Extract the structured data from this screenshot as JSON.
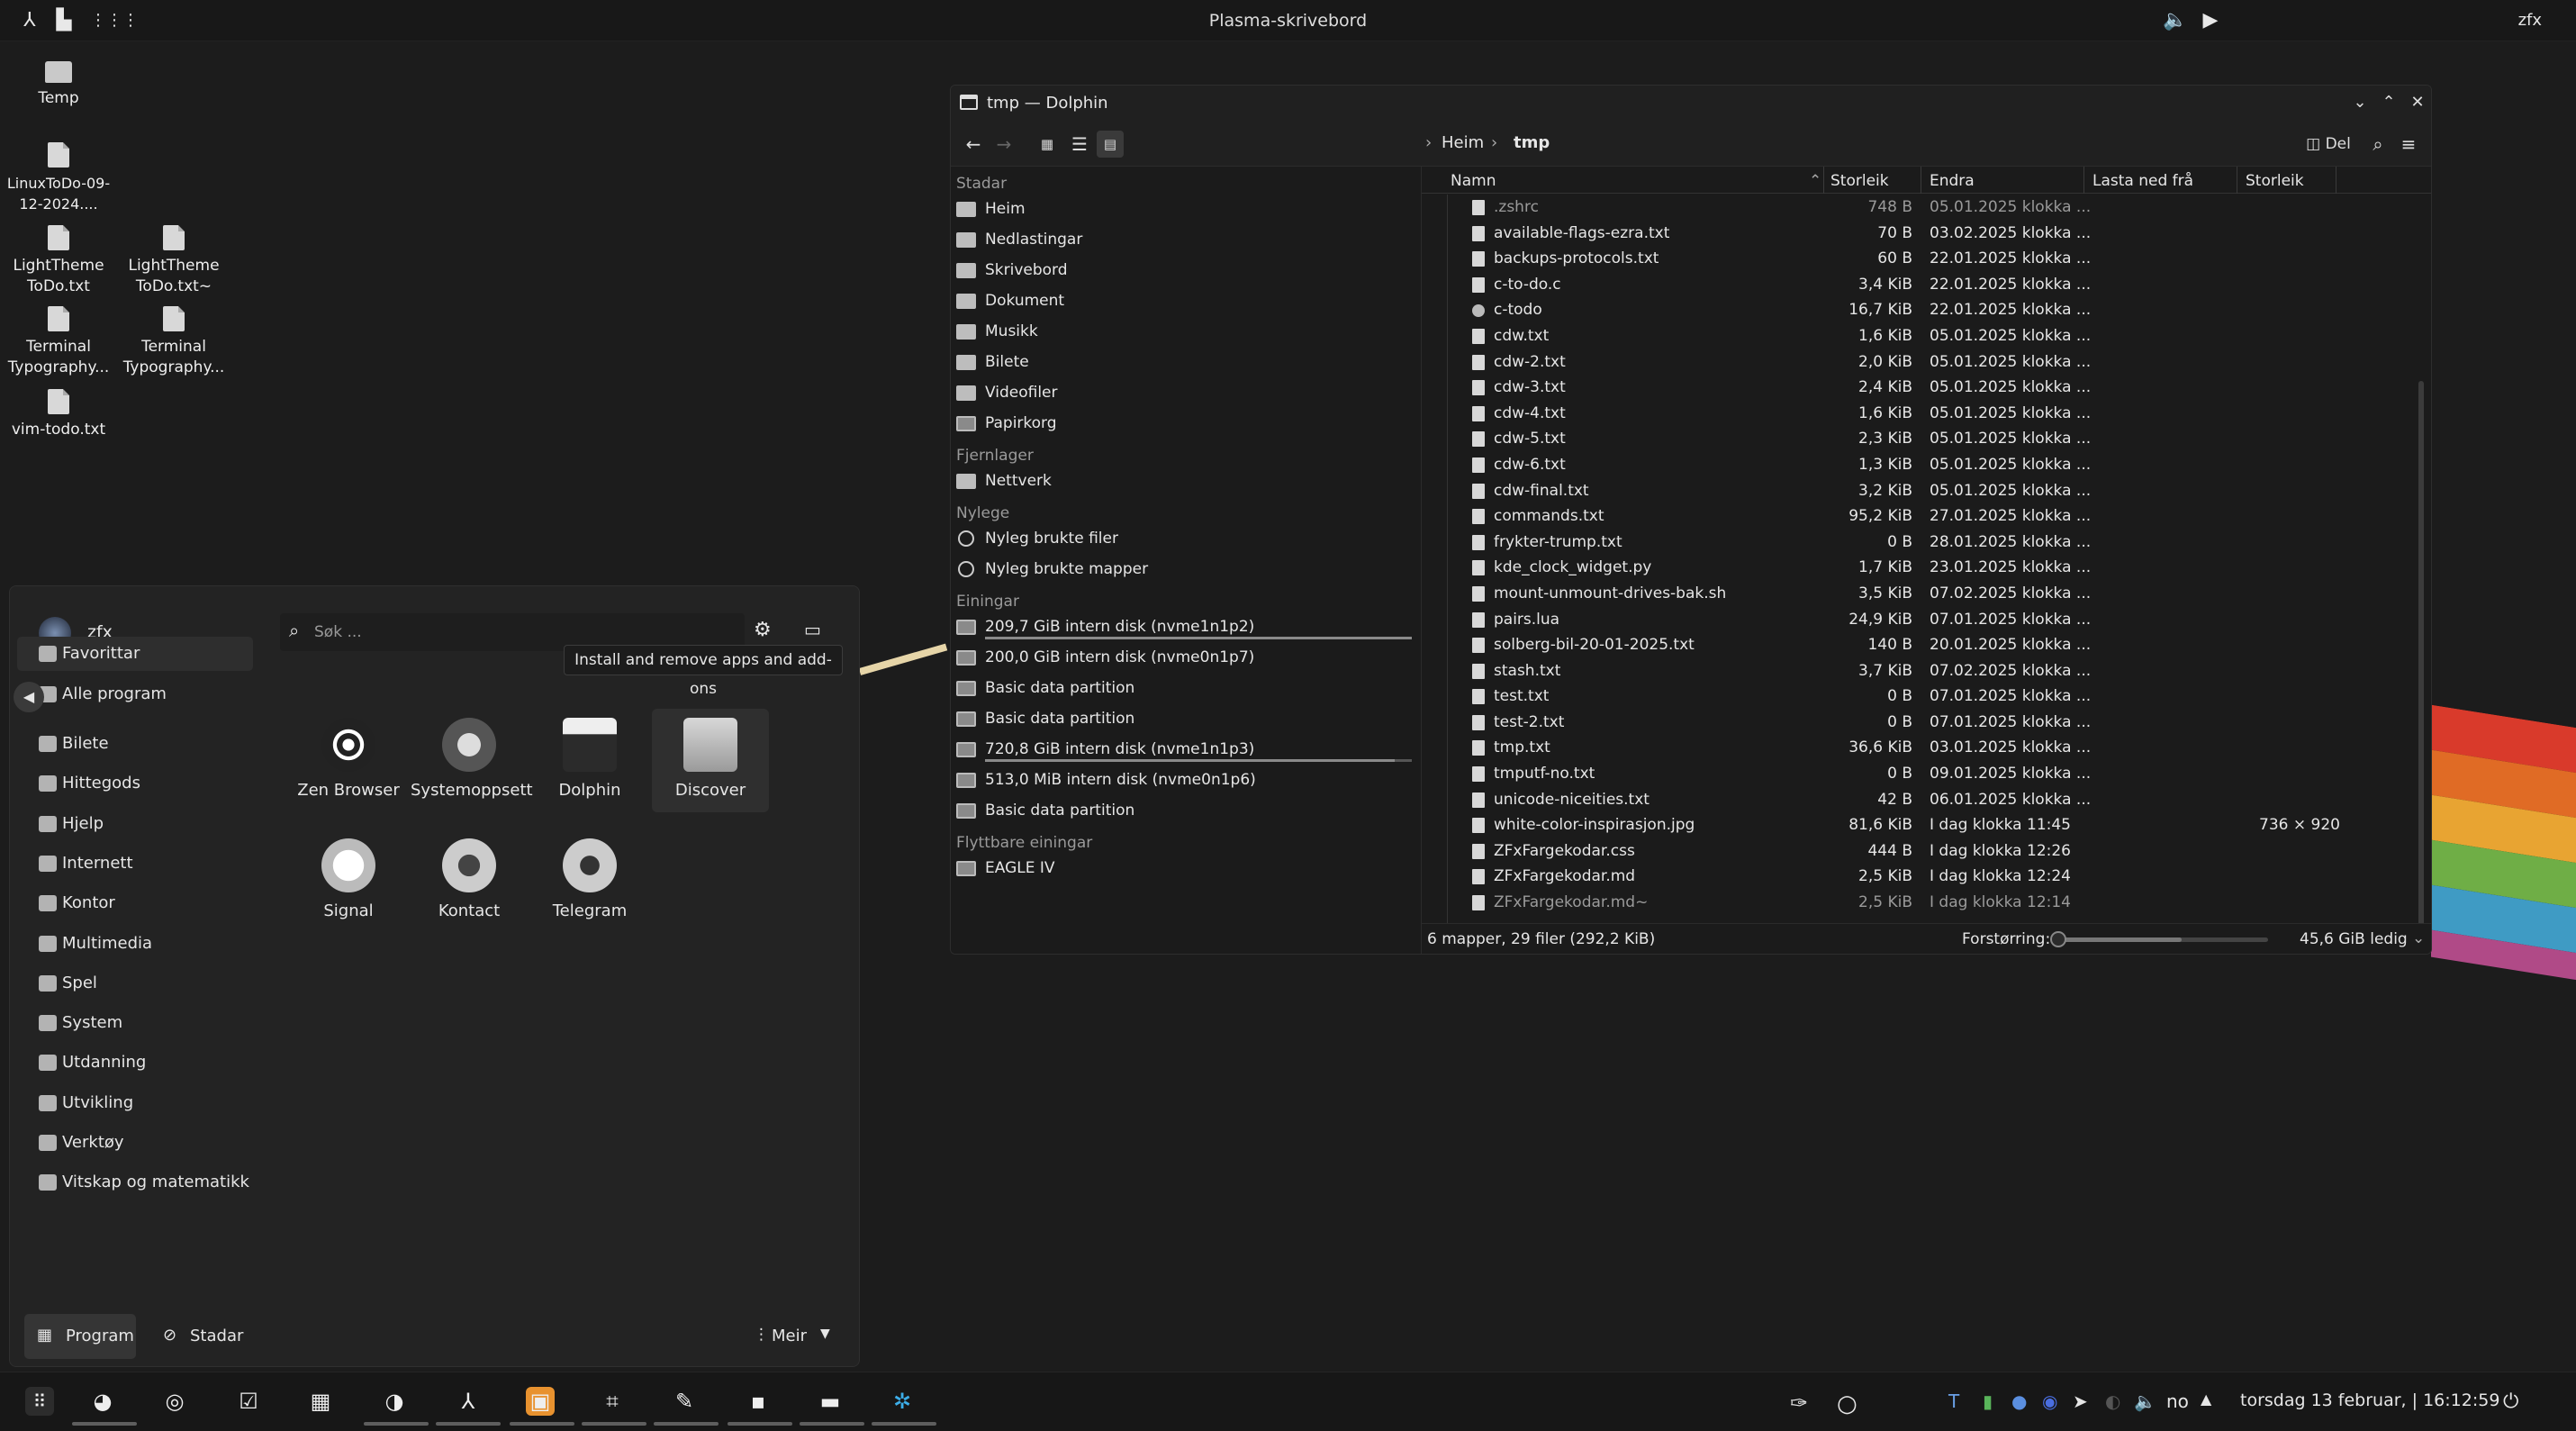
{
  "topbar": {
    "title": "Plasma-skrivebord",
    "user": "zfx"
  },
  "desktop": {
    "icons": [
      {
        "label": "Temp",
        "kind": "folder"
      },
      {
        "label": "LinuxToDo-09-12-2024....",
        "kind": "file"
      },
      {
        "label": "LightTheme ToDo.txt",
        "kind": "file"
      },
      {
        "label": "LightTheme ToDo.txt~",
        "kind": "file"
      },
      {
        "label": "Terminal Typography...",
        "kind": "file"
      },
      {
        "label": "Terminal Typography...",
        "kind": "file"
      },
      {
        "label": "vim-todo.txt",
        "kind": "file"
      }
    ]
  },
  "dolphin": {
    "title": "tmp — Dolphin",
    "breadcrumb": {
      "home": "Heim",
      "current": "tmp"
    },
    "split_label": "Del",
    "places": {
      "sections": [
        {
          "title": "Stadar",
          "items": [
            "Heim",
            "Nedlastingar",
            "Skrivebord",
            "Dokument",
            "Musikk",
            "Bilete",
            "Videofiler",
            "Papirkorg"
          ]
        },
        {
          "title": "Fjernlager",
          "items": [
            "Nettverk"
          ]
        },
        {
          "title": "Nylege",
          "items": [
            "Nyleg brukte filer",
            "Nyleg brukte mapper"
          ]
        },
        {
          "title": "Einingar",
          "items": [
            "209,7 GiB intern disk (nvme1n1p2)",
            "200,0 GiB intern disk (nvme0n1p7)",
            "Basic data partition",
            "Basic data partition",
            "720,8 GiB intern disk (nvme1n1p3)",
            "513,0 MiB intern disk (nvme0n1p6)",
            "Basic data partition"
          ]
        },
        {
          "title": "Flyttbare einingar",
          "items": [
            "EAGLE IV"
          ]
        }
      ]
    },
    "columns": {
      "name": "Namn",
      "size": "Storleik",
      "modified": "Endra",
      "downloaded": "Lasta ned frå",
      "size2": "Storleik"
    },
    "files": [
      {
        "name": ".zshrc",
        "size": "748 B",
        "date": "05.01.2025 klokka ..."
      },
      {
        "name": "available-flags-ezra.txt",
        "size": "70 B",
        "date": "03.02.2025 klokka ..."
      },
      {
        "name": "backups-protocols.txt",
        "size": "60 B",
        "date": "22.01.2025 klokka ..."
      },
      {
        "name": "c-to-do.c",
        "size": "3,4 KiB",
        "date": "22.01.2025 klokka ..."
      },
      {
        "name": "c-todo",
        "size": "16,7 KiB",
        "date": "22.01.2025 klokka ..."
      },
      {
        "name": "cdw.txt",
        "size": "1,6 KiB",
        "date": "05.01.2025 klokka ..."
      },
      {
        "name": "cdw-2.txt",
        "size": "2,0 KiB",
        "date": "05.01.2025 klokka ..."
      },
      {
        "name": "cdw-3.txt",
        "size": "2,4 KiB",
        "date": "05.01.2025 klokka ..."
      },
      {
        "name": "cdw-4.txt",
        "size": "1,6 KiB",
        "date": "05.01.2025 klokka ..."
      },
      {
        "name": "cdw-5.txt",
        "size": "2,3 KiB",
        "date": "05.01.2025 klokka ..."
      },
      {
        "name": "cdw-6.txt",
        "size": "1,3 KiB",
        "date": "05.01.2025 klokka ..."
      },
      {
        "name": "cdw-final.txt",
        "size": "3,2 KiB",
        "date": "05.01.2025 klokka ..."
      },
      {
        "name": "commands.txt",
        "size": "95,2 KiB",
        "date": "27.01.2025 klokka ..."
      },
      {
        "name": "frykter-trump.txt",
        "size": "0 B",
        "date": "28.01.2025 klokka ..."
      },
      {
        "name": "kde_clock_widget.py",
        "size": "1,7 KiB",
        "date": "23.01.2025 klokka ..."
      },
      {
        "name": "mount-unmount-drives-bak.sh",
        "size": "3,5 KiB",
        "date": "07.02.2025 klokka ..."
      },
      {
        "name": "pairs.lua",
        "size": "24,9 KiB",
        "date": "07.01.2025 klokka ..."
      },
      {
        "name": "solberg-bil-20-01-2025.txt",
        "size": "140 B",
        "date": "20.01.2025 klokka ..."
      },
      {
        "name": "stash.txt",
        "size": "3,7 KiB",
        "date": "07.02.2025 klokka ..."
      },
      {
        "name": "test.txt",
        "size": "0 B",
        "date": "07.01.2025 klokka ..."
      },
      {
        "name": "test-2.txt",
        "size": "0 B",
        "date": "07.01.2025 klokka ..."
      },
      {
        "name": "tmp.txt",
        "size": "36,6 KiB",
        "date": "03.01.2025 klokka ..."
      },
      {
        "name": "tmputf-no.txt",
        "size": "0 B",
        "date": "09.01.2025 klokka ..."
      },
      {
        "name": "unicode-niceities.txt",
        "size": "42 B",
        "date": "06.01.2025 klokka ..."
      },
      {
        "name": "white-color-inspirasjon.jpg",
        "size": "81,6 KiB",
        "date": "I dag klokka 11:45",
        "extra": "736 × 920"
      },
      {
        "name": "ZFxFargekodar.css",
        "size": "444 B",
        "date": "I dag klokka 12:26"
      },
      {
        "name": "ZFxFargekodar.md",
        "size": "2,5 KiB",
        "date": "I dag klokka 12:24"
      },
      {
        "name": "ZFxFargekodar.md~",
        "size": "2,5 KiB",
        "date": "I dag klokka 12:14"
      }
    ],
    "status": {
      "summary": "6 mapper, 29 filer (292,2 KiB)",
      "zoom_label": "Forstørring:",
      "free": "45,6 GiB ledig"
    }
  },
  "launcher": {
    "user": "zfx",
    "search_placeholder": "Søk ...",
    "categories": [
      "Favorittar",
      "Alle program",
      "Bilete",
      "Hittegods",
      "Hjelp",
      "Internett",
      "Kontor",
      "Multimedia",
      "Spel",
      "System",
      "Utdanning",
      "Utvikling",
      "Verktøy",
      "Vitskap og matematikk"
    ],
    "apps": [
      "Zen Browser",
      "Systemoppsett",
      "Dolphin",
      "Discover",
      "Signal",
      "Kontact",
      "Telegram"
    ],
    "tooltip": "Install and remove apps and add-ons",
    "footer": {
      "programs": "Program",
      "places": "Stadar",
      "more": "Meir"
    }
  },
  "panel": {
    "lang": "no",
    "clock": "torsdag 13 februar, | 16:12:59"
  },
  "colors": {
    "accent": "#3daee9",
    "rainbow": [
      "#d93a2b",
      "#e06b25",
      "#e8a432",
      "#6fae46",
      "#3f9bc4",
      "#b04a87"
    ]
  }
}
